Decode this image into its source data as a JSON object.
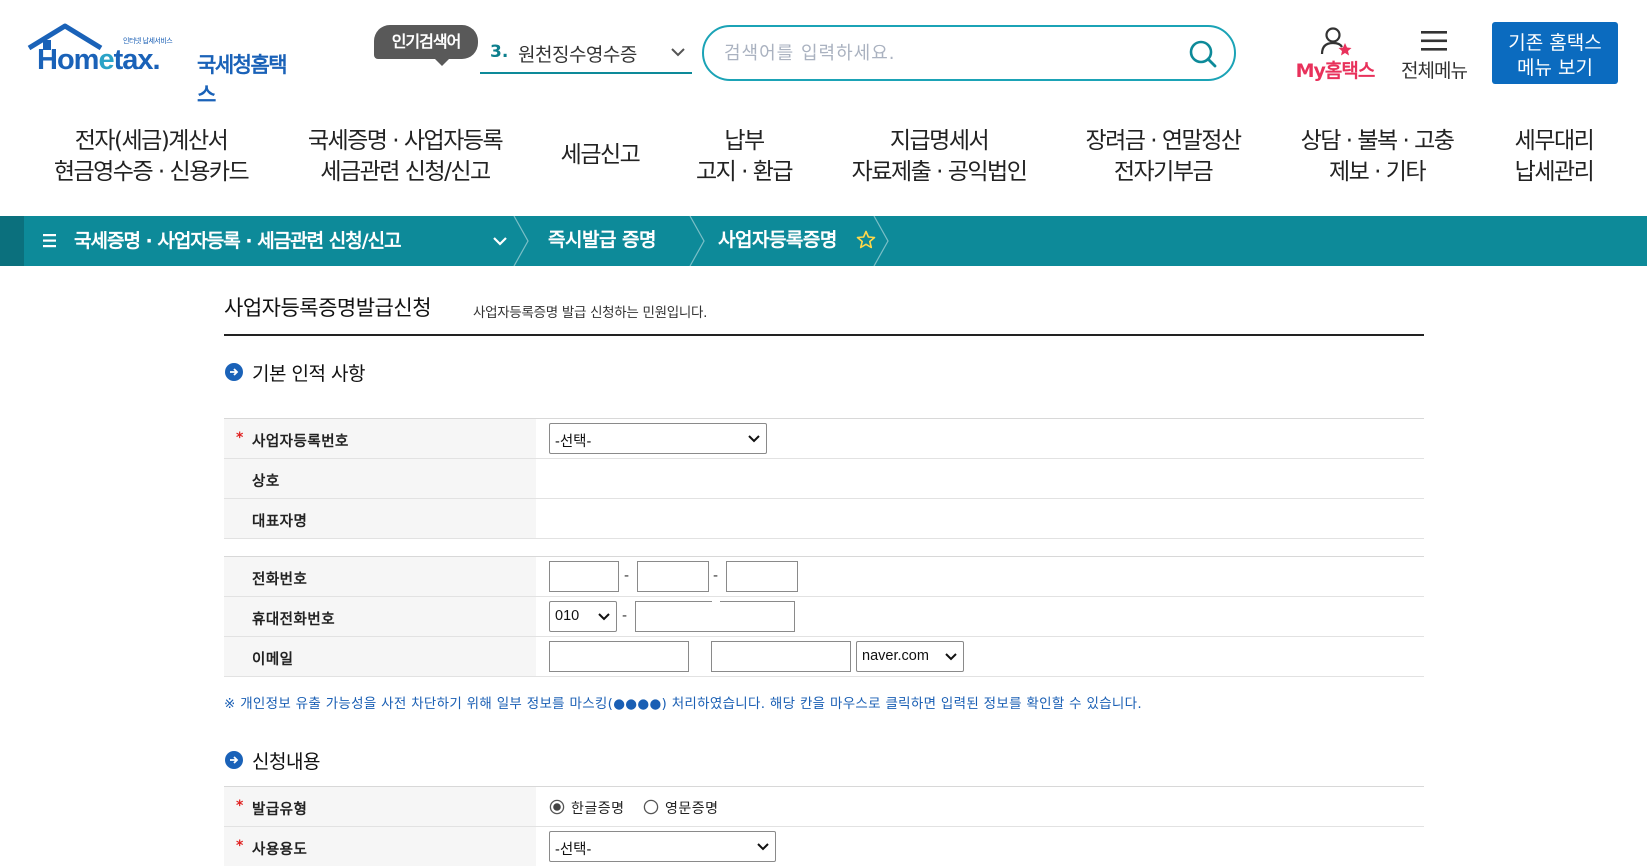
{
  "header": {
    "logo_small": "인터넷 납세서비스",
    "logo_text_a": "Hom",
    "logo_text_e": "e",
    "logo_text_b": "tax.",
    "logo_kr": "국세청홈택스",
    "popular_badge": "인기검색어",
    "popular_rank": "3.",
    "popular_word": "원천징수영수증",
    "search_placeholder": "검색어를 입력하세요.",
    "my_hometax_a": "My",
    "my_hometax_b": "홈택스",
    "all_menu": "전체메뉴",
    "legacy_line1": "기존 홈택스",
    "legacy_line2": "메뉴 보기"
  },
  "gnb": [
    {
      "line1": "전자(세금)계산서",
      "line2": "현금영수증 · 신용카드"
    },
    {
      "line1": "국세증명 · 사업자등록",
      "line2": "세금관련 신청/신고"
    },
    {
      "line1": "세금신고",
      "line2": ""
    },
    {
      "line1": "납부",
      "line2": "고지 · 환급"
    },
    {
      "line1": "지급명세서",
      "line2": "자료제출 · 공익법인"
    },
    {
      "line1": "장려금 · 연말정산",
      "line2": "전자기부금"
    },
    {
      "line1": "상담 · 불복 · 고충",
      "line2": "제보 · 기타"
    },
    {
      "line1": "세무대리",
      "line2": "납세관리"
    }
  ],
  "breadcrumb": {
    "menu": "국세증명 · 사업자등록 · 세금관련 신청/신고",
    "item1": "즉시발급 증명",
    "item2": "사업자등록증명"
  },
  "page": {
    "title": "사업자등록증명발급신청",
    "desc": "사업자등록증명 발급 신청하는 민원입니다."
  },
  "section1": {
    "title": "기본 인적 사항",
    "required_mark": "*",
    "biz_no_label": "사업자등록번호",
    "biz_no_value": "-선택-",
    "trade_name_label": "상호",
    "rep_name_label": "대표자명",
    "phone_label": "전화번호",
    "mobile_label": "휴대전화번호",
    "mobile_prefix": "010",
    "email_label": "이메일",
    "email_domain": "naver.com",
    "dash": "-"
  },
  "notice": "※ 개인정보 유출 가능성을 사전 차단하기 위해 일부 정보를 마스킹(●●●●) 처리하였습니다. 해당 칸을 마우스로 클릭하면 입력된 정보를 확인할 수 있습니다.",
  "section2": {
    "title": "신청내용",
    "issue_type_label": "발급유형",
    "issue_type_options": [
      "한글증명",
      "영문증명"
    ],
    "usage_label": "사용용도",
    "usage_value": "-선택-"
  },
  "colors": {
    "teal": "#0d8a99",
    "teal_dark": "#0b707d",
    "blue": "#0b6bbf",
    "pink": "#e8315b"
  }
}
